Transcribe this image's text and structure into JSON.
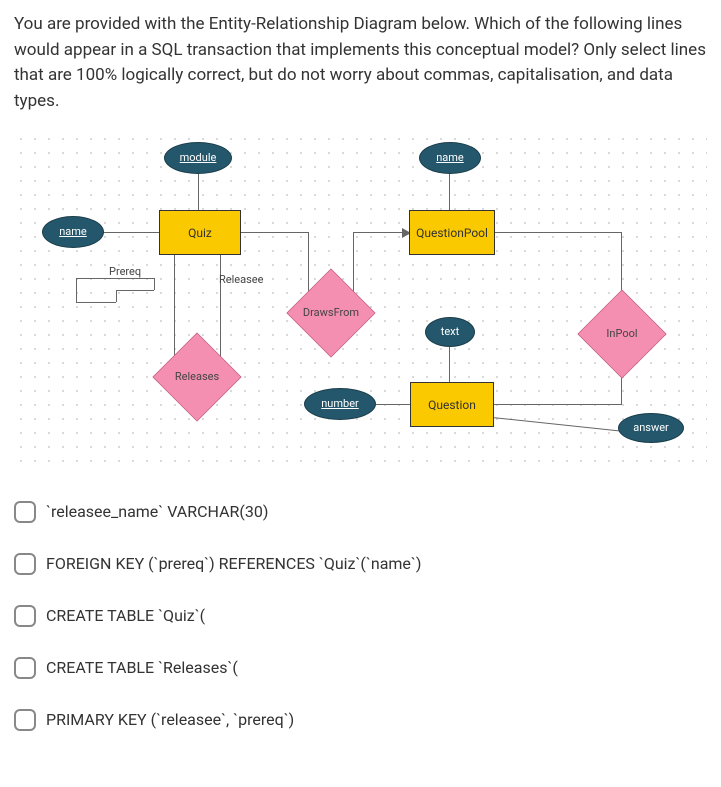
{
  "question": {
    "prompt": "You are provided with the Entity-Relationship Diagram below. Which of the following lines would appear in a SQL transaction that implements this conceptual model? Only select lines that are 100% logically correct, but do not worry about commas, capitalisation, and data types."
  },
  "er_diagram": {
    "entities": [
      {
        "id": "Quiz",
        "label": "Quiz"
      },
      {
        "id": "QuestionPool",
        "label": "QuestionPool"
      },
      {
        "id": "Question",
        "label": "Question"
      }
    ],
    "attributes": [
      {
        "label": "module",
        "of": "Quiz",
        "key": true
      },
      {
        "label": "name",
        "of": "Quiz",
        "key": true
      },
      {
        "label": "name",
        "of": "QuestionPool",
        "key": true
      },
      {
        "label": "number",
        "of": "Question",
        "key": true
      },
      {
        "label": "text",
        "of": "Question",
        "key": false
      },
      {
        "label": "answer",
        "of": "Question",
        "key": false
      }
    ],
    "relationships": [
      {
        "label": "Releases",
        "between": [
          "Quiz",
          "Quiz"
        ],
        "roles": [
          "Prereq",
          "Releasee"
        ]
      },
      {
        "label": "DrawsFrom",
        "between": [
          "Quiz",
          "QuestionPool"
        ]
      },
      {
        "label": "InPool",
        "between": [
          "QuestionPool",
          "Question"
        ]
      }
    ]
  },
  "options": [
    {
      "label": "`releasee_name` VARCHAR(30)"
    },
    {
      "label": "FOREIGN KEY (`prereq`) REFERENCES `Quiz`(`name`)"
    },
    {
      "label": "CREATE TABLE `Quiz`("
    },
    {
      "label": "CREATE TABLE `Releases`("
    },
    {
      "label": "PRIMARY KEY (`releasee`, `prereq`)"
    }
  ]
}
